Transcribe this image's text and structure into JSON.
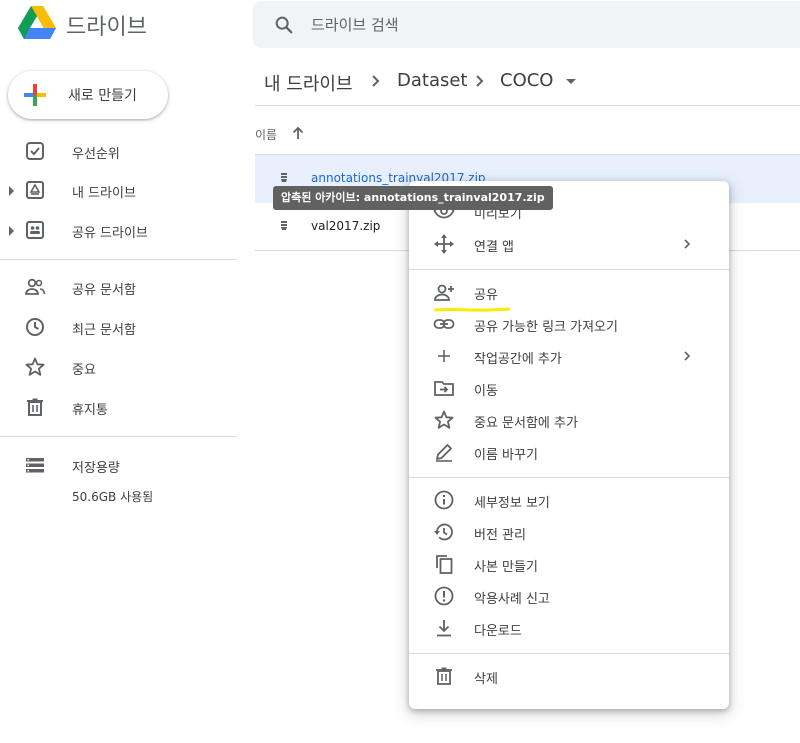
{
  "header": {
    "app_name": "드라이브",
    "search_placeholder": "드라이브 검색"
  },
  "sidebar": {
    "new_label": "새로 만들기",
    "items": [
      {
        "label": "우선순위",
        "icon": "priority-check-icon"
      },
      {
        "label": "내 드라이브",
        "icon": "my-drive-icon"
      },
      {
        "label": "공유 드라이브",
        "icon": "shared-drive-icon"
      },
      {
        "label": "공유 문서함",
        "icon": "people-icon"
      },
      {
        "label": "최근 문서함",
        "icon": "clock-icon"
      },
      {
        "label": "중요",
        "icon": "star-icon"
      },
      {
        "label": "휴지통",
        "icon": "trash-icon"
      },
      {
        "label": "저장용량",
        "icon": "storage-icon"
      }
    ],
    "storage_used": "50.6GB 사용됨"
  },
  "breadcrumb": {
    "items": [
      "내 드라이브",
      "Dataset",
      "COCO"
    ]
  },
  "file_list": {
    "sort_column": "이름",
    "files": [
      {
        "name": "annotations_trainval2017.zip"
      },
      {
        "name": "val2017.zip"
      }
    ],
    "tooltip": "압축된 아카이브: annotations_trainval2017.zip"
  },
  "context_menu": {
    "items": [
      {
        "label": "미리보기",
        "icon": "eye-icon"
      },
      {
        "label": "연결 앱",
        "icon": "open-with-icon"
      },
      {
        "label": "공유",
        "icon": "person-add-icon"
      },
      {
        "label": "공유 가능한 링크 가져오기",
        "icon": "link-icon"
      },
      {
        "label": "작업공간에 추가",
        "icon": "plus-icon"
      },
      {
        "label": "이동",
        "icon": "move-folder-icon"
      },
      {
        "label": "중요 문서함에 추가",
        "icon": "star-icon"
      },
      {
        "label": "이름 바꾸기",
        "icon": "pencil-icon"
      },
      {
        "label": "세부정보 보기",
        "icon": "info-icon"
      },
      {
        "label": "버전 관리",
        "icon": "history-icon"
      },
      {
        "label": "사본 만들기",
        "icon": "copy-icon"
      },
      {
        "label": "악용사례 신고",
        "icon": "report-icon"
      },
      {
        "label": "다운로드",
        "icon": "download-icon"
      },
      {
        "label": "삭제",
        "icon": "trash-icon"
      }
    ]
  },
  "colors": {
    "selection_bg": "#e8f0fe",
    "selection_text": "#1967d2",
    "highlight_marker": "#ffeb00"
  }
}
